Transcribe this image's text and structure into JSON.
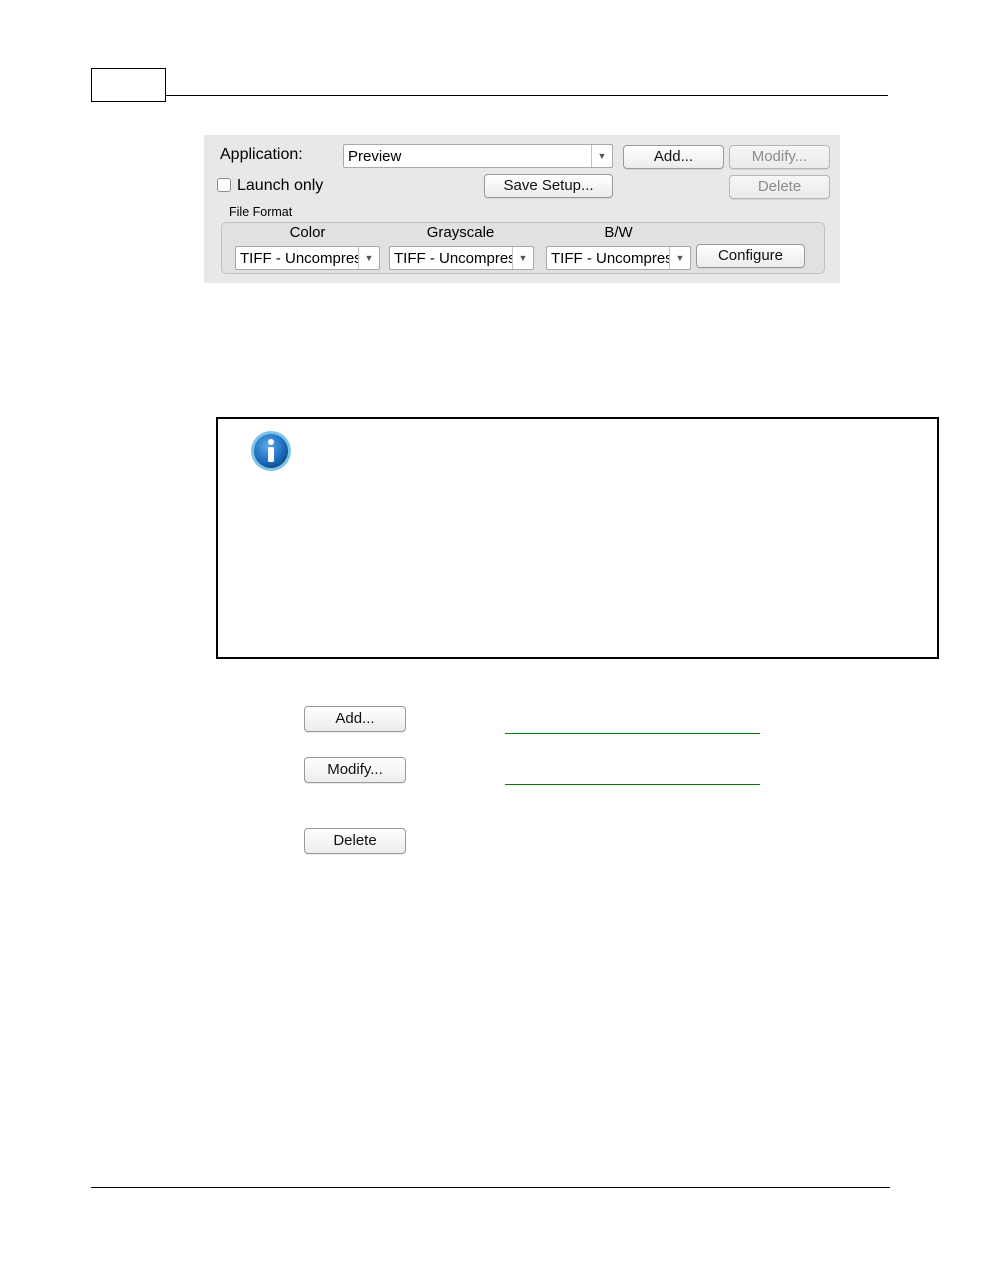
{
  "header": {
    "page_number": ""
  },
  "panel": {
    "application_label": "Application:",
    "application_value": "Preview",
    "add_label": "Add...",
    "modify_label": "Modify...",
    "delete_label": "Delete",
    "launch_only_label": "Launch only",
    "launch_only_checked": false,
    "save_setup_label": "Save Setup...",
    "file_format_label": "File Format",
    "columns": {
      "color": {
        "label": "Color",
        "value": "TIFF - Uncompressed"
      },
      "grayscale": {
        "label": "Grayscale",
        "value": "TIFF - Uncompressed"
      },
      "bw": {
        "label": "B/W",
        "value": "TIFF - Uncompressed"
      }
    },
    "configure_label": "Configure"
  },
  "note": {
    "icon": "info-icon",
    "text": ""
  },
  "doc_buttons": {
    "add_label": "Add...",
    "add_link_text": "",
    "modify_label": "Modify...",
    "modify_link_text": "",
    "delete_label": "Delete"
  },
  "colors": {
    "panel_bg": "#e8e8e8",
    "link_green": "#0a7a0a",
    "info_blue": "#1e6fbf"
  }
}
